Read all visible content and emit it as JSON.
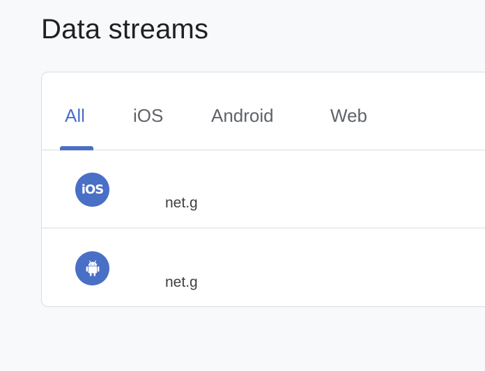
{
  "page": {
    "title": "Data streams"
  },
  "tabs": [
    {
      "label": "All",
      "active": true
    },
    {
      "label": "iOS",
      "active": false
    },
    {
      "label": "Android",
      "active": false
    },
    {
      "label": "Web",
      "active": false
    }
  ],
  "streams": [
    {
      "platform_icon": "ios-icon",
      "platform_glyph": "iOS",
      "stream_id": "net.g"
    },
    {
      "platform_icon": "android-icon",
      "stream_id": "net.g"
    }
  ],
  "colors": {
    "accent": "#4a6fc6",
    "background": "#f8f9fa",
    "card": "#ffffff",
    "divider": "#dadce0",
    "tab_text": "#5f6368",
    "title_text": "#202124"
  }
}
